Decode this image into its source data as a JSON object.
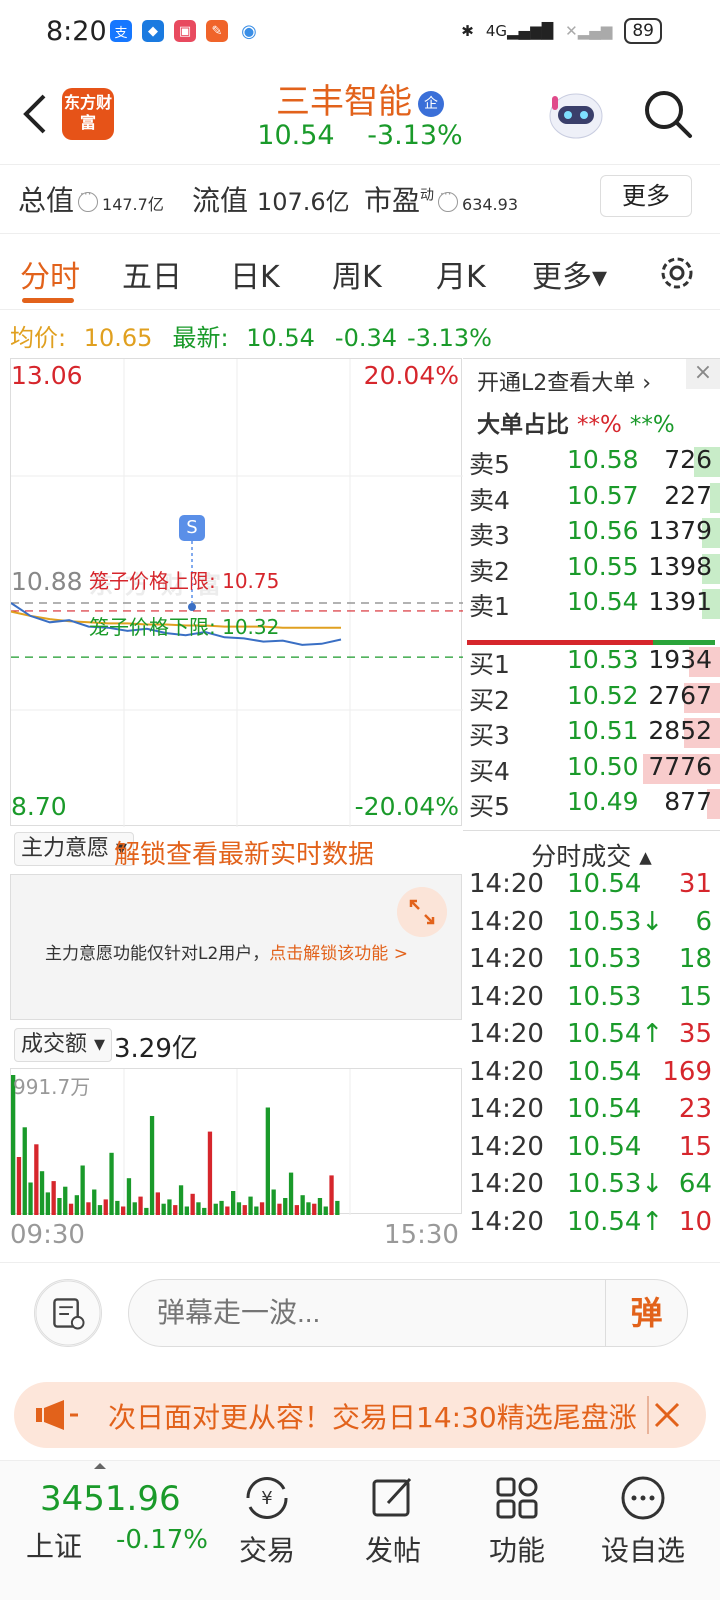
{
  "status_bar": {
    "time": "8:20",
    "battery": "89",
    "network": "4G"
  },
  "header": {
    "logo_text": "东方财富",
    "stock_name": "三丰智能",
    "badge": "企",
    "price": "10.54",
    "change_pct": "-3.13%"
  },
  "metrics": {
    "total_value_label": "总值",
    "total_value": "147.7亿",
    "float_value_label": "流值",
    "float_value": "107.6亿",
    "pe_label": "市盈",
    "pe_sup": "动",
    "pe_value": "634.93",
    "more_label": "更多"
  },
  "tabs": [
    {
      "label": "分时",
      "active": true
    },
    {
      "label": "五日",
      "active": false
    },
    {
      "label": "日K",
      "active": false
    },
    {
      "label": "周K",
      "active": false
    },
    {
      "label": "月K",
      "active": false
    },
    {
      "label": "更多▾",
      "active": false
    }
  ],
  "info_line": {
    "avg_label": "均价:",
    "avg_value": "10.65",
    "latest_label": "最新:",
    "latest_value": "10.54",
    "change": "-0.34",
    "change_pct": "-3.13%"
  },
  "chart": {
    "top_price": "13.06",
    "top_pct": "20.04%",
    "bottom_price": "8.70",
    "bottom_pct": "-20.04%",
    "ref_price": "10.88",
    "upper_limit_label": "笼子价格上限:  10.75",
    "lower_limit_label": "笼子价格下限:  10.32",
    "marker": "S",
    "watermark": "东方财富"
  },
  "chart_data": {
    "type": "line",
    "ylim": [
      8.7,
      13.06
    ],
    "ref": 10.88,
    "upper_cage": 10.75,
    "lower_cage": 10.32,
    "avg_line": [
      10.8,
      10.76,
      10.73,
      10.71,
      10.7,
      10.69,
      10.69,
      10.68,
      10.68,
      10.67,
      10.67,
      10.66,
      10.66,
      10.66,
      10.65,
      10.65,
      10.65,
      10.65
    ],
    "price_line": [
      10.88,
      10.76,
      10.7,
      10.72,
      10.66,
      10.65,
      10.62,
      10.64,
      10.6,
      10.58,
      10.61,
      10.56,
      10.55,
      10.52,
      10.53,
      10.49,
      10.5,
      10.54
    ],
    "volume": [
      9.9,
      4.1,
      6.2,
      2.3,
      5.0,
      3.1,
      1.6,
      2.4,
      1.2,
      2.0,
      0.8,
      1.4,
      3.5,
      0.9,
      1.8,
      0.7,
      1.1,
      4.4,
      1.0,
      0.6,
      2.6,
      0.9,
      1.3,
      0.5,
      7.0,
      1.6,
      0.8,
      1.1,
      0.7,
      2.1,
      0.6,
      1.5,
      0.9,
      0.5,
      5.9,
      0.8,
      1.0,
      0.6,
      1.7,
      0.9,
      0.7,
      1.3,
      0.6,
      0.9,
      7.6,
      1.8,
      0.8,
      1.2,
      3.0,
      0.7,
      1.4,
      0.9,
      0.8,
      1.2,
      0.6,
      2.8,
      1.0
    ],
    "volume_max_label": "991.7万",
    "x_start": "09:30",
    "x_end": "15:30"
  },
  "order_book": {
    "l2_link": "开通L2查看大单 ›",
    "close": "×",
    "ratio_label": "大单占比",
    "ratio_red": "**%",
    "ratio_green": "**%",
    "asks": [
      {
        "label": "卖5",
        "price": "10.58",
        "vol": "726",
        "bar": 0.1,
        "color": "#c8ecc8"
      },
      {
        "label": "卖4",
        "price": "10.57",
        "vol": "227",
        "bar": 0.04,
        "color": "#c8ecc8"
      },
      {
        "label": "卖3",
        "price": "10.56",
        "vol": "1379",
        "bar": 0.07,
        "color": "#c8ecc8"
      },
      {
        "label": "卖2",
        "price": "10.55",
        "vol": "1398",
        "bar": 0.07,
        "color": "#c8ecc8"
      },
      {
        "label": "卖1",
        "price": "10.54",
        "vol": "1391",
        "bar": 0.07,
        "color": "#c8ecc8"
      }
    ],
    "bids": [
      {
        "label": "买1",
        "price": "10.53",
        "vol": "1934",
        "bar": 0.12,
        "color": "#f8cccc"
      },
      {
        "label": "买2",
        "price": "10.52",
        "vol": "2767",
        "bar": 0.14,
        "color": "#f8cccc"
      },
      {
        "label": "买3",
        "price": "10.51",
        "vol": "2852",
        "bar": 0.14,
        "color": "#f8cccc"
      },
      {
        "label": "买4",
        "price": "10.50",
        "vol": "7776",
        "bar": 0.3,
        "color": "#f8cccc"
      },
      {
        "label": "买5",
        "price": "10.49",
        "vol": "877",
        "bar": 0.05,
        "color": "#f8cccc"
      }
    ]
  },
  "main_force": {
    "dropdown": "主力意愿 ▾",
    "unlock": "解锁查看最新实时数据",
    "notice": "主力意愿功能仅针对L2用户，",
    "notice_link": "点击解锁该功能 >"
  },
  "trades": {
    "title": "分时成交 ▴",
    "rows": [
      {
        "time": "14:20",
        "price": "10.54",
        "vol": "31",
        "vcolor": "#d6262c"
      },
      {
        "time": "14:20",
        "price": "10.53↓",
        "vol": "6",
        "vcolor": "#1a9a2a"
      },
      {
        "time": "14:20",
        "price": "10.53",
        "vol": "18",
        "vcolor": "#1a9a2a"
      },
      {
        "time": "14:20",
        "price": "10.53",
        "vol": "15",
        "vcolor": "#1a9a2a"
      },
      {
        "time": "14:20",
        "price": "10.54↑",
        "vol": "35",
        "vcolor": "#d6262c"
      },
      {
        "time": "14:20",
        "price": "10.54",
        "vol": "169",
        "vcolor": "#d6262c"
      },
      {
        "time": "14:20",
        "price": "10.54",
        "vol": "23",
        "vcolor": "#d6262c"
      },
      {
        "time": "14:20",
        "price": "10.54",
        "vol": "15",
        "vcolor": "#d6262c"
      },
      {
        "time": "14:20",
        "price": "10.53↓",
        "vol": "64",
        "vcolor": "#1a9a2a"
      },
      {
        "time": "14:20",
        "price": "10.54↑",
        "vol": "10",
        "vcolor": "#d6262c"
      }
    ]
  },
  "volume_section": {
    "dropdown": "成交额 ▾",
    "value": "3.29亿"
  },
  "comment": {
    "placeholder": "弹幕走一波...",
    "send": "弹"
  },
  "promo": {
    "text": "次日面对更从容！交易日14:30精选尾盘涨"
  },
  "bottom_nav": {
    "index_value": "3451.96",
    "index_name": "上证",
    "index_pct": "-0.17%",
    "items": [
      "交易",
      "发帖",
      "功能",
      "设自选"
    ]
  },
  "colors": {
    "up": "#d6262c",
    "down": "#1a9a2a",
    "brand": "#e2621b",
    "avg": "#e0a020"
  }
}
